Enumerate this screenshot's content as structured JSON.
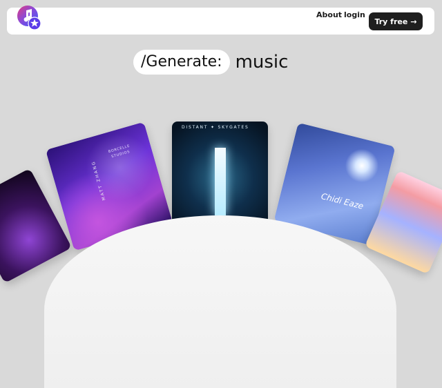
{
  "header": {
    "nav_about": "About",
    "nav_login": "login",
    "try_free": "Try free",
    "try_free_icon": "arrow-right-icon"
  },
  "hero": {
    "prefix": "/Generate:",
    "word": "music"
  },
  "cards": {
    "purple_title": "BORCELLE STUDIOS",
    "purple_side": "MATT ZHANG",
    "sky_title": "DISTANT ✦ SKYGATES",
    "blue_script": "Chidi Eaze"
  }
}
